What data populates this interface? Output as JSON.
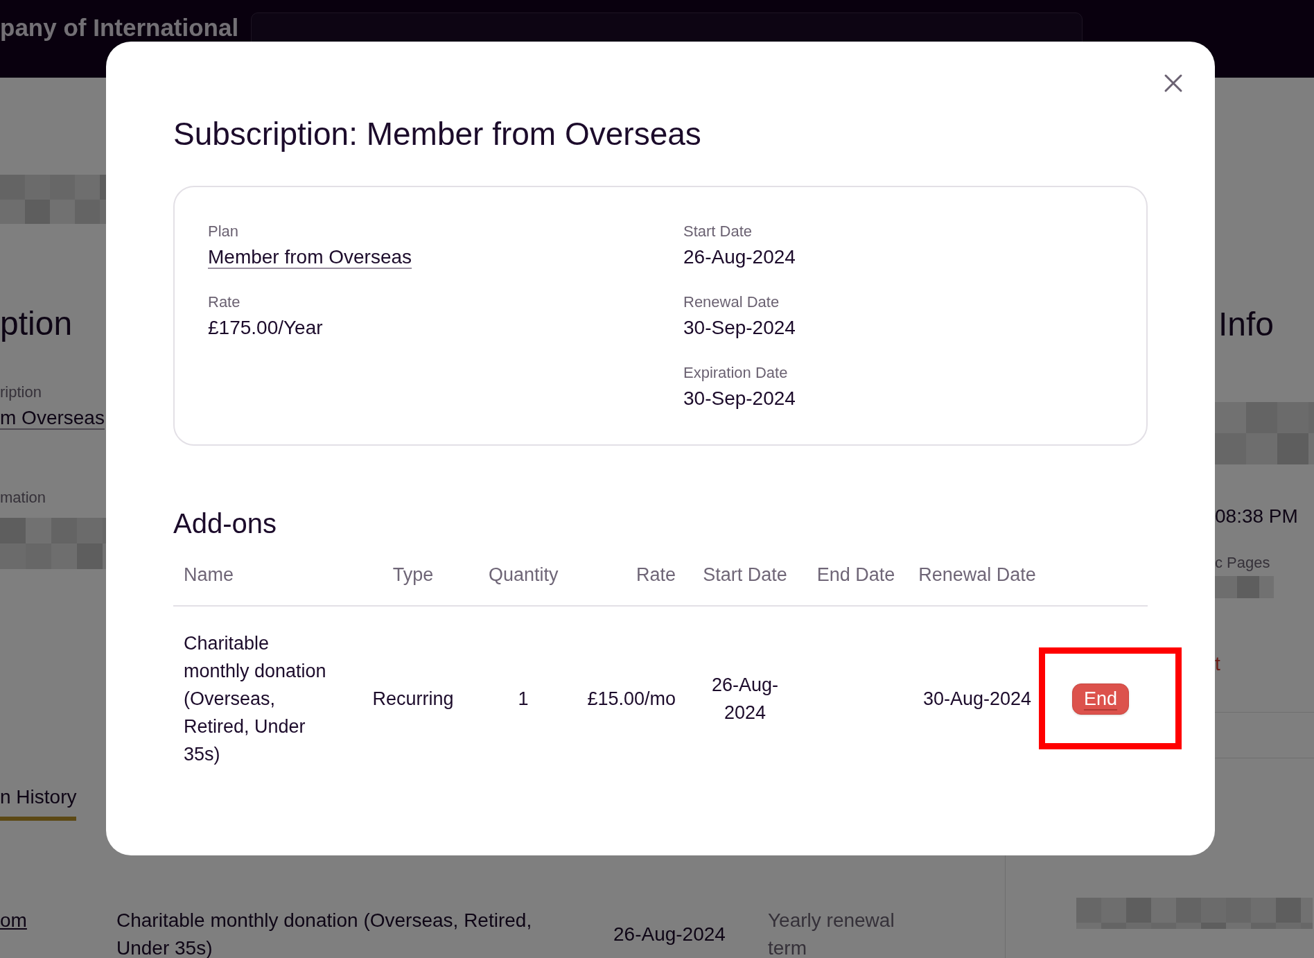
{
  "page": {
    "brand": "pany of International",
    "left_panel": {
      "heading": "ption",
      "subscription_label": "ription",
      "subscription_value": "m Overseas",
      "info_label": "mation",
      "tabs": [
        {
          "label": "n History",
          "selected": true
        }
      ]
    },
    "history_table": {
      "rows": [
        {
          "column_1": "om",
          "column_2": "Charitable monthly donation (Overseas, Retired, Under 35s)",
          "column_3": "26-Aug-2024",
          "column_4": "Yearly renewal term"
        }
      ]
    },
    "right_panel": {
      "heading": "Info",
      "time": "08:38 PM",
      "pages_label": "c Pages",
      "red_link": "t"
    }
  },
  "modal": {
    "title": "Subscription: Member from Overseas",
    "details": {
      "left": [
        {
          "label": "Plan",
          "value": "Member from Overseas",
          "kind": "link"
        },
        {
          "label": "Rate",
          "value": "£175.00/Year",
          "kind": "text"
        }
      ],
      "right": [
        {
          "label": "Start Date",
          "value": "26-Aug-2024",
          "kind": "text"
        },
        {
          "label": "Renewal Date",
          "value": "30-Sep-2024",
          "kind": "text"
        },
        {
          "label": "Expiration Date",
          "value": "30-Sep-2024",
          "kind": "text"
        }
      ]
    },
    "addons": {
      "heading": "Add-ons",
      "columns": [
        "Name",
        "Type",
        "Quantity",
        "Rate",
        "Start Date",
        "End Date",
        "Renewal Date"
      ],
      "rows": [
        {
          "name": "Charitable monthly donation (Overseas, Retired, Under 35s)",
          "type": "Recurring",
          "quantity": "1",
          "rate": "£15.00/mo",
          "start_date": "26-Aug-2024",
          "renewal_date": "30-Aug-2024",
          "action": "End"
        }
      ]
    }
  }
}
